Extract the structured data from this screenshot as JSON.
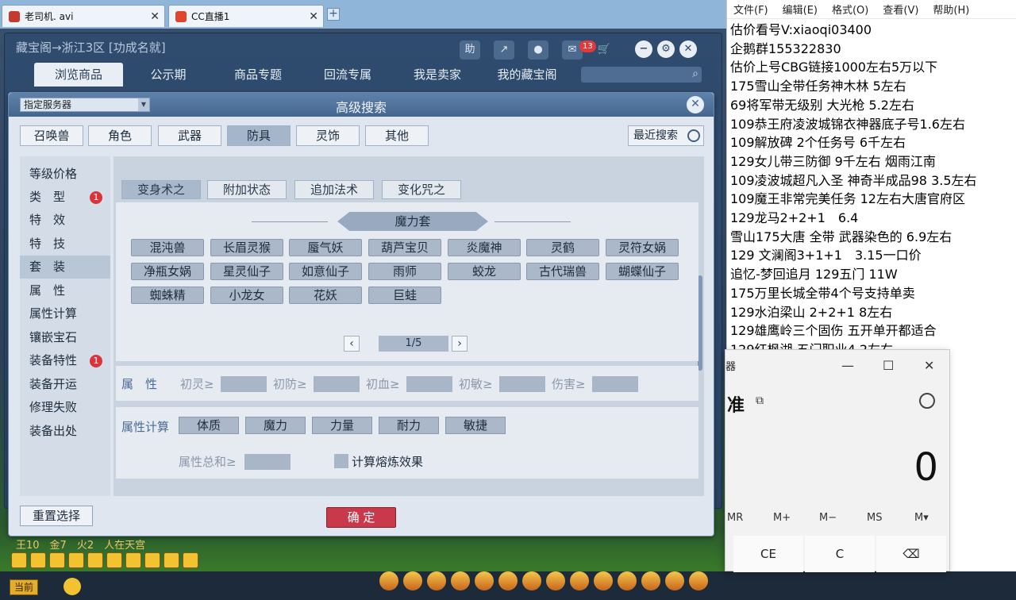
{
  "browser": {
    "tabs": [
      {
        "label": "老司机. avi"
      },
      {
        "label": "CC直播1"
      }
    ]
  },
  "cbg": {
    "title": "藏宝阁→浙江3区 [功成名就]",
    "toolbar": {
      "help": "助",
      "message_count": "13"
    },
    "nav": [
      "浏览商品",
      "公示期",
      "商品专题",
      "回流专属",
      "我是卖家",
      "我的藏宝阁"
    ]
  },
  "dialog": {
    "server_select": "指定服务器",
    "title": "高级搜索",
    "categories": [
      "召唤兽",
      "角色",
      "武器",
      "防具",
      "灵饰",
      "其他"
    ],
    "active_category": "防具",
    "recent_search": "最近搜索",
    "left_nav": [
      {
        "label": "等级价格",
        "badge": ""
      },
      {
        "label": "类　型",
        "badge": "1"
      },
      {
        "label": "特　效",
        "badge": ""
      },
      {
        "label": "特　技",
        "badge": ""
      },
      {
        "label": "套　装",
        "badge": ""
      },
      {
        "label": "属　性",
        "badge": ""
      },
      {
        "label": "属性计算",
        "badge": ""
      },
      {
        "label": "镶嵌宝石",
        "badge": ""
      },
      {
        "label": "装备特性",
        "badge": "1"
      },
      {
        "label": "装备开运",
        "badge": ""
      },
      {
        "label": "修理失败",
        "badge": ""
      },
      {
        "label": "装备出处",
        "badge": ""
      }
    ],
    "suit_subtabs": [
      "变身术之",
      "附加状态",
      "追加法术",
      "变化咒之"
    ],
    "suit_group": "魔力套",
    "suits": [
      "混沌兽",
      "长眉灵猴",
      "蜃气妖",
      "葫芦宝贝",
      "炎魔神",
      "灵鹤",
      "灵符女娲",
      "净瓶女娲",
      "星灵仙子",
      "如意仙子",
      "雨师",
      "蛟龙",
      "古代瑞兽",
      "蝴蝶仙子",
      "蜘蛛精",
      "小龙女",
      "花妖",
      "巨蛙"
    ],
    "page": "1/5",
    "attr_label": "属　性",
    "attr_fields": [
      "初灵≥",
      "初防≥",
      "初血≥",
      "初敏≥",
      "伤害≥"
    ],
    "calc_label": "属性计算",
    "calc_buttons": [
      "体质",
      "魔力",
      "力量",
      "耐力",
      "敏捷"
    ],
    "attr_sum": "属性总和≥",
    "smelt": "计算熔炼效果",
    "reset": "重置选择",
    "confirm": "确 定"
  },
  "game": {
    "stats": "王10　金7　火2　人在天宫",
    "channel": "当前"
  },
  "notepad": {
    "menu": [
      "文件(F)",
      "编辑(E)",
      "格式(O)",
      "查看(V)",
      "帮助(H)"
    ],
    "lines": [
      "估价看号V:xiaoqi03400",
      "企鹅群155322830",
      "估价上号CBG链接1000左右5万以下",
      "175雪山全带任务神木林 5左右",
      "69将军带无级别 大光枪 5.2左右",
      "109恭王府凌波城锦衣神器底子号1.6左右",
      "109解放碑 2个任务号 6千左右",
      "129女儿带三防御 9千左右 烟雨江南",
      "109凌波城超凡入圣 神奇半成品98 3.5左右",
      "109魔王非常完美任务 12左右大唐官府区",
      "129龙马2+2+1　6.4",
      "雪山175大唐 全带 武器染色的 6.9左右",
      "129 文澜阁3+1+1　3.15一口价",
      "追忆-梦回追月 129五门 11W",
      "175万里长城全带4个号支持单卖",
      "129水泊梁山 2+2+1 8左右",
      "129雄鹰岭三个固伤 五开单开都适合",
      "129红枫湖 五门职业4.2左右"
    ]
  },
  "calculator": {
    "title": "器",
    "mode": "准",
    "display": "0",
    "memory": [
      "MR",
      "M+",
      "M−",
      "MS",
      "M▾"
    ],
    "keys": [
      "CE",
      "C",
      "⌫"
    ]
  }
}
